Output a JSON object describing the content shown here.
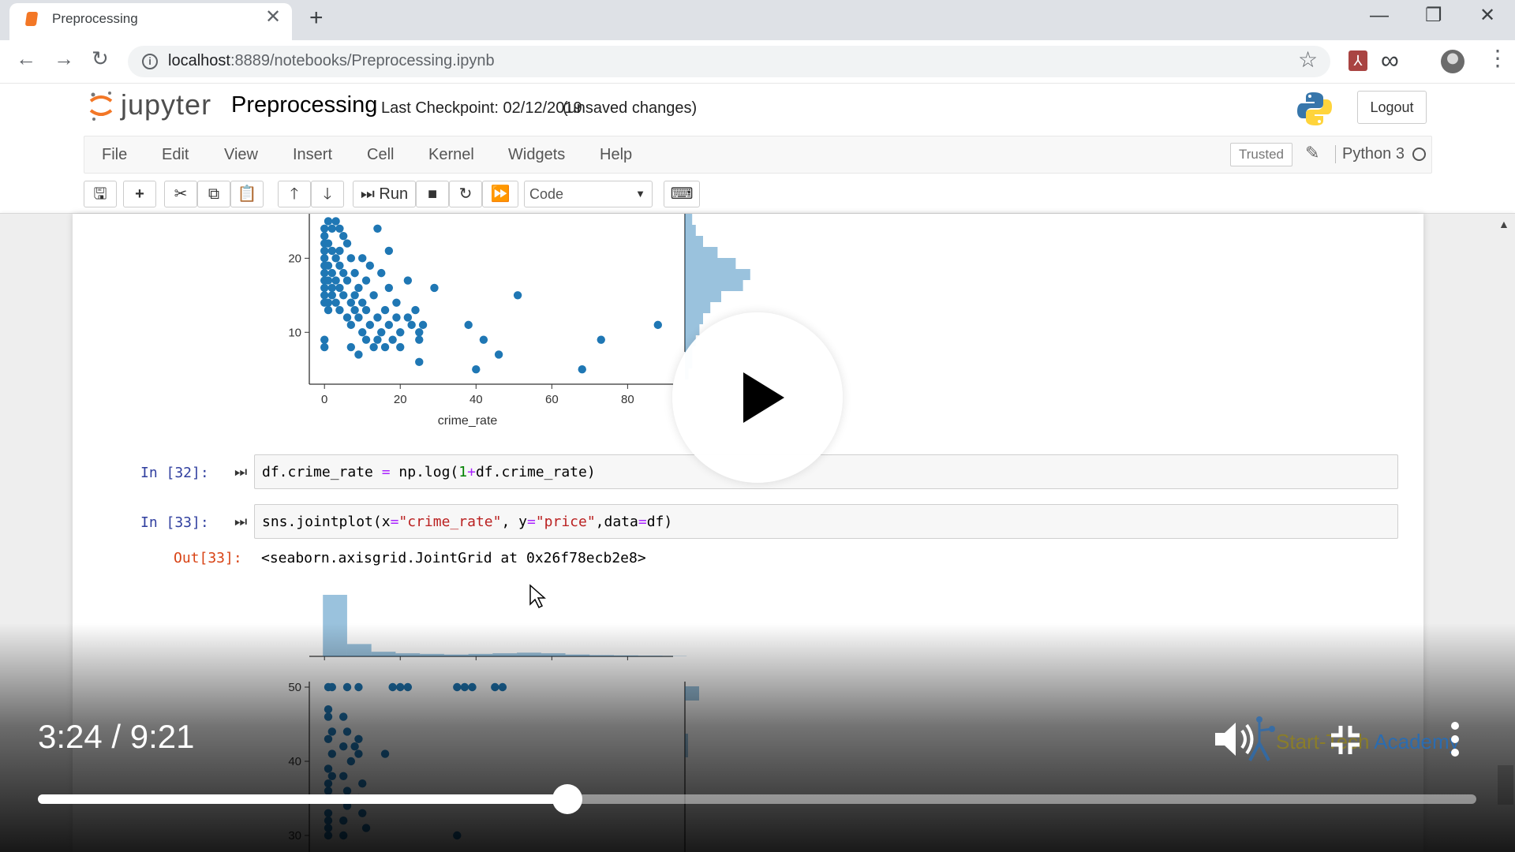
{
  "browser": {
    "tab_title": "Preprocessing",
    "tab_close": "✕",
    "new_tab": "+",
    "url_host": "localhost",
    "url_rest": ":8889/notebooks/Preprocessing.ipynb",
    "window_controls": [
      "—",
      "❐",
      "✕"
    ]
  },
  "jupyter": {
    "logo_text": "jupyter",
    "notebook_name": "Preprocessing",
    "checkpoint": "Last Checkpoint: 02/12/2019",
    "unsaved": "(unsaved changes)",
    "logout": "Logout",
    "menu": [
      "File",
      "Edit",
      "View",
      "Insert",
      "Cell",
      "Kernel",
      "Widgets",
      "Help"
    ],
    "trusted": "Trusted",
    "kernel": "Python 3",
    "run_label": "Run",
    "cell_type": "Code"
  },
  "cells": [
    {
      "prompt": "In [32]:",
      "code": "df.crime_rate = np.log(1+df.crime_rate)"
    },
    {
      "prompt": "In [33]:",
      "code": "sns.jointplot(x=\"crime_rate\", y=\"price\",data=df)"
    }
  ],
  "output": {
    "prompt": "Out[33]:",
    "text": "<seaborn.axisgrid.JointGrid at 0x26f78ecb2e8>"
  },
  "chart_data": [
    {
      "type": "scatter",
      "xlabel": "crime_rate",
      "ylabel": "",
      "xticks": [
        0,
        20,
        40,
        60,
        80
      ],
      "yticks": [
        10,
        20
      ],
      "xlim": [
        -4,
        92
      ],
      "ylim": [
        3,
        26
      ],
      "color": "#1f77b4",
      "points": [
        [
          0,
          24
        ],
        [
          0,
          23
        ],
        [
          0,
          22
        ],
        [
          0,
          21
        ],
        [
          0,
          20
        ],
        [
          0,
          19
        ],
        [
          0,
          18
        ],
        [
          0,
          17
        ],
        [
          0,
          16
        ],
        [
          0,
          15
        ],
        [
          0,
          14
        ],
        [
          0,
          9
        ],
        [
          0,
          8
        ],
        [
          1,
          25
        ],
        [
          1,
          22
        ],
        [
          1,
          19
        ],
        [
          1,
          17
        ],
        [
          1,
          14
        ],
        [
          1,
          13
        ],
        [
          2,
          24
        ],
        [
          2,
          21
        ],
        [
          2,
          18
        ],
        [
          2,
          16
        ],
        [
          2,
          15
        ],
        [
          3,
          25
        ],
        [
          3,
          20
        ],
        [
          3,
          17
        ],
        [
          3,
          14
        ],
        [
          4,
          24
        ],
        [
          4,
          21
        ],
        [
          4,
          19
        ],
        [
          4,
          16
        ],
        [
          4,
          13
        ],
        [
          5,
          23
        ],
        [
          5,
          18
        ],
        [
          5,
          15
        ],
        [
          6,
          22
        ],
        [
          6,
          17
        ],
        [
          6,
          12
        ],
        [
          7,
          20
        ],
        [
          7,
          14
        ],
        [
          7,
          11
        ],
        [
          7,
          8
        ],
        [
          8,
          18
        ],
        [
          8,
          15
        ],
        [
          8,
          13
        ],
        [
          9,
          16
        ],
        [
          9,
          12
        ],
        [
          9,
          7
        ],
        [
          10,
          20
        ],
        [
          10,
          14
        ],
        [
          10,
          10
        ],
        [
          11,
          17
        ],
        [
          11,
          13
        ],
        [
          11,
          9
        ],
        [
          12,
          19
        ],
        [
          12,
          11
        ],
        [
          13,
          15
        ],
        [
          13,
          8
        ],
        [
          14,
          24
        ],
        [
          14,
          12
        ],
        [
          14,
          9
        ],
        [
          15,
          18
        ],
        [
          15,
          10
        ],
        [
          16,
          13
        ],
        [
          16,
          8
        ],
        [
          17,
          21
        ],
        [
          17,
          16
        ],
        [
          17,
          11
        ],
        [
          18,
          9
        ],
        [
          19,
          14
        ],
        [
          19,
          12
        ],
        [
          20,
          10
        ],
        [
          20,
          8
        ],
        [
          22,
          17
        ],
        [
          22,
          12
        ],
        [
          23,
          11
        ],
        [
          24,
          13
        ],
        [
          25,
          10
        ],
        [
          25,
          9
        ],
        [
          26,
          11
        ],
        [
          25,
          6
        ],
        [
          29,
          16
        ],
        [
          38,
          11
        ],
        [
          42,
          9
        ],
        [
          40,
          5
        ],
        [
          46,
          7
        ],
        [
          51,
          15
        ],
        [
          68,
          5
        ],
        [
          73,
          9
        ],
        [
          88,
          11
        ]
      ],
      "marginal_y_hist": [
        2,
        3,
        5,
        9,
        14,
        18,
        16,
        10,
        7,
        5,
        4,
        3,
        2,
        2,
        1
      ]
    },
    {
      "type": "scatter",
      "xlabel": "",
      "ylabel": "",
      "yticks": [
        30,
        40,
        50
      ],
      "xlim": [
        -4,
        92
      ],
      "ylim": [
        29,
        52
      ],
      "color": "#1f77b4",
      "points": [
        [
          1,
          50
        ],
        [
          2,
          50
        ],
        [
          6,
          50
        ],
        [
          9,
          50
        ],
        [
          18,
          50
        ],
        [
          20,
          50
        ],
        [
          22,
          50
        ],
        [
          35,
          50
        ],
        [
          37,
          50
        ],
        [
          39,
          50
        ],
        [
          45,
          50
        ],
        [
          47,
          50
        ],
        [
          1,
          47
        ],
        [
          1,
          46
        ],
        [
          2,
          44
        ],
        [
          1,
          43
        ],
        [
          2,
          41
        ],
        [
          1,
          39
        ],
        [
          2,
          38
        ],
        [
          1,
          37
        ],
        [
          1,
          36
        ],
        [
          2,
          35
        ],
        [
          1,
          33
        ],
        [
          1,
          32
        ],
        [
          1,
          31
        ],
        [
          1,
          30
        ],
        [
          5,
          46
        ],
        [
          6,
          44
        ],
        [
          5,
          42
        ],
        [
          7,
          40
        ],
        [
          5,
          38
        ],
        [
          6,
          36
        ],
        [
          6,
          34
        ],
        [
          5,
          32
        ],
        [
          5,
          30
        ],
        [
          9,
          43
        ],
        [
          8,
          42
        ],
        [
          9,
          41
        ],
        [
          10,
          37
        ],
        [
          9,
          35
        ],
        [
          10,
          33
        ],
        [
          11,
          31
        ],
        [
          16,
          41
        ],
        [
          35,
          30
        ]
      ],
      "marginal_x_hist": [
        20,
        4,
        1.5,
        1,
        0.8,
        0.6,
        0.8,
        1,
        1.2,
        1,
        0.6,
        0.4,
        0.3,
        0.2,
        0.1
      ]
    }
  ],
  "video": {
    "time": "3:24 / 9:21",
    "progress": 0.368,
    "watermark_a": "Start-Tech",
    "watermark_b": " Academy"
  }
}
